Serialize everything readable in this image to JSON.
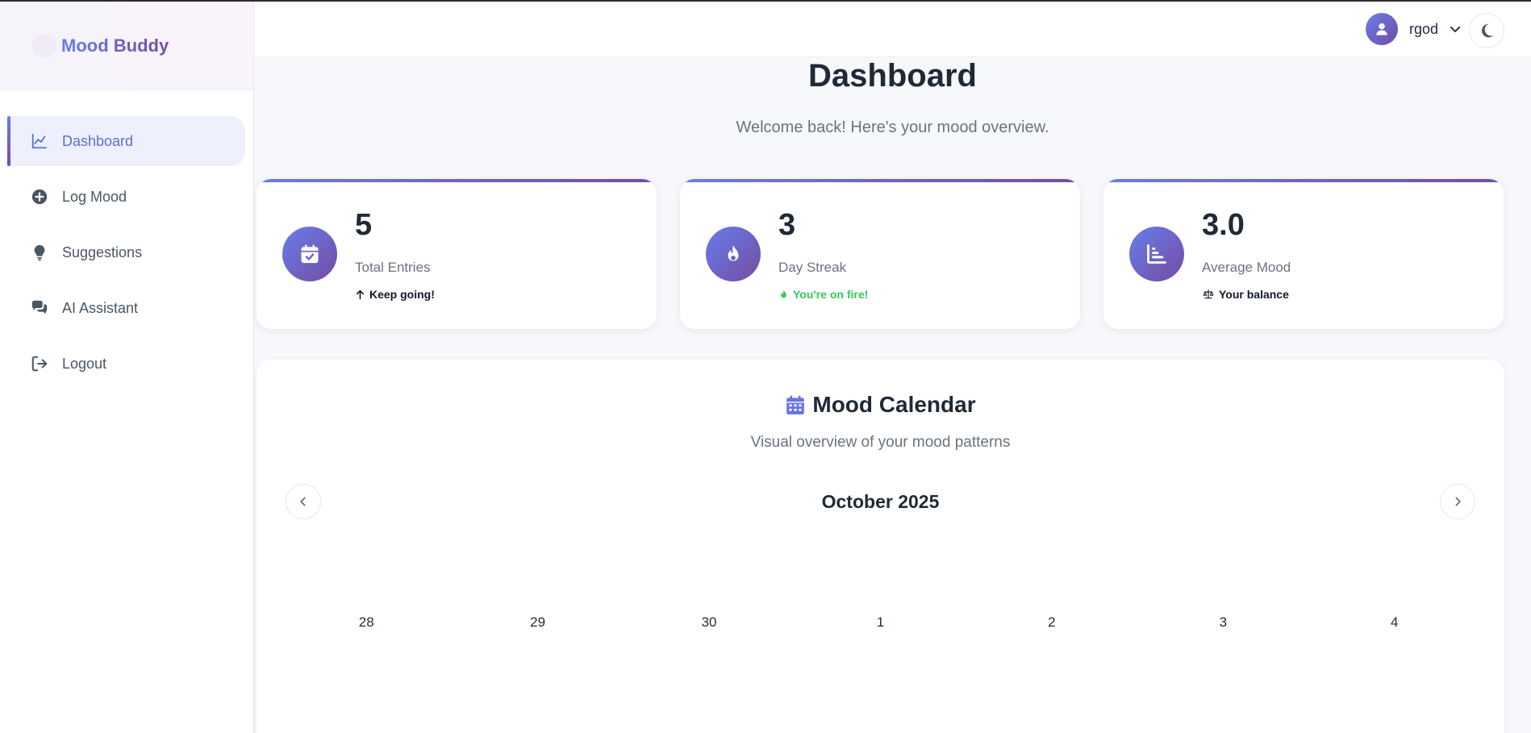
{
  "brand": {
    "name": "Mood Buddy"
  },
  "sidebar": {
    "items": [
      {
        "label": "Dashboard",
        "icon": "chart-line-icon"
      },
      {
        "label": "Log Mood",
        "icon": "plus-circle-icon"
      },
      {
        "label": "Suggestions",
        "icon": "lightbulb-icon"
      },
      {
        "label": "AI Assistant",
        "icon": "comments-icon"
      },
      {
        "label": "Logout",
        "icon": "logout-icon"
      }
    ]
  },
  "header": {
    "username": "rgod"
  },
  "main": {
    "title": "Dashboard",
    "subtitle": "Welcome back! Here's your mood overview."
  },
  "stats": [
    {
      "value": "5",
      "label": "Total Entries",
      "note": "Keep going!"
    },
    {
      "value": "3",
      "label": "Day Streak",
      "note": "You're on fire!"
    },
    {
      "value": "3.0",
      "label": "Average Mood",
      "note": "Your balance"
    }
  ],
  "calendar": {
    "title": "Mood Calendar",
    "subtitle": "Visual overview of your mood patterns",
    "month": "October 2025",
    "days": [
      "28",
      "29",
      "30",
      "1",
      "2",
      "3",
      "4"
    ]
  },
  "colors": {
    "accent_start": "#667eea",
    "accent_end": "#764ba2",
    "success": "#34c759"
  }
}
